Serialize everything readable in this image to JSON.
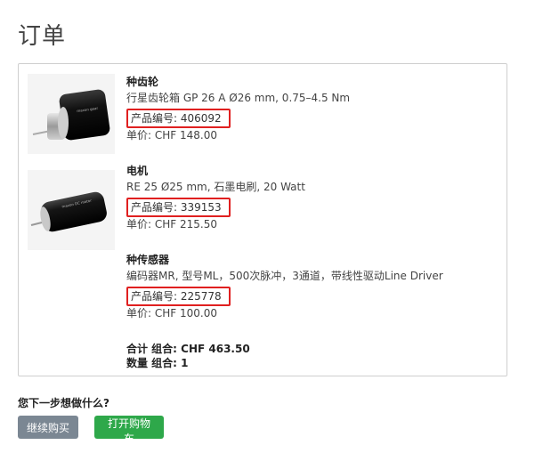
{
  "page": {
    "title": "订单"
  },
  "items": [
    {
      "name": "种齿轮",
      "desc": "行星齿轮箱 GP 26 A Ø26 mm, 0.75–4.5 Nm",
      "code": "产品编号: 406092",
      "price": "单价: CHF 148.00",
      "image_label": "maxon planetary gearhead"
    },
    {
      "name": "电机",
      "desc": "RE 25 Ø25 mm, 石墨电刷, 20 Watt",
      "code": "产品编号: 339153",
      "price": "单价: CHF 215.50",
      "image_label": "maxon RE 25 motor"
    },
    {
      "name": "种传感器",
      "desc": "编码器MR, 型号ML，500次脉冲，3通道，带线性驱动Line Driver",
      "code": "产品编号: 225778",
      "price": "单价: CHF 100.00"
    }
  ],
  "summary": {
    "total": "合计 组合: CHF 463.50",
    "quantity": "数量 组合: 1"
  },
  "next_step": {
    "question": "您下一步想做什么?",
    "continue_label": "继续购买",
    "open_cart_label": "打开购物车"
  },
  "colors": {
    "highlight_border": "#e02020",
    "continue_button": "#7b8793",
    "cart_button": "#2ea84a"
  }
}
